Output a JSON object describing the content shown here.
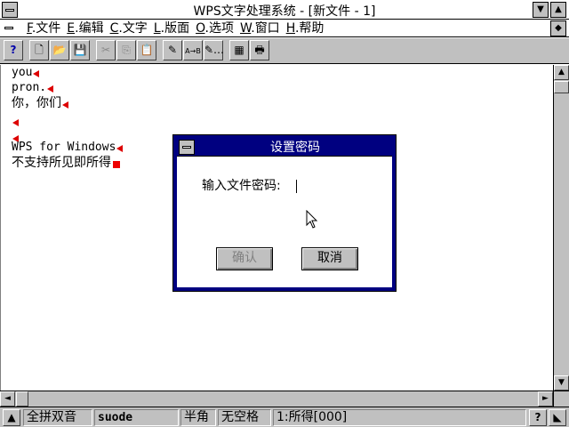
{
  "window": {
    "title": "WPS文字处理系统 - [新文件 - 1]",
    "min_glyph": "▼",
    "max_glyph": "▲"
  },
  "menubar": {
    "items": [
      {
        "key": "F",
        "label": "文件"
      },
      {
        "key": "E",
        "label": "编辑"
      },
      {
        "key": "C",
        "label": "文字"
      },
      {
        "key": "L",
        "label": "版面"
      },
      {
        "key": "O",
        "label": "选项"
      },
      {
        "key": "W",
        "label": "窗口"
      },
      {
        "key": "H",
        "label": "帮助"
      }
    ],
    "restore_glyph": "◆"
  },
  "toolbar": {
    "tools": [
      {
        "name": "help-tool",
        "glyph": "?",
        "disabled": false
      },
      {
        "name": "new-file-tool",
        "glyph": "🗋",
        "disabled": false
      },
      {
        "name": "open-file-tool",
        "glyph": "📂",
        "disabled": false
      },
      {
        "name": "save-file-tool",
        "glyph": "💾",
        "disabled": false
      },
      {
        "name": "cut-tool",
        "glyph": "✂",
        "disabled": true
      },
      {
        "name": "copy-tool",
        "glyph": "⎘",
        "disabled": true
      },
      {
        "name": "paste-tool",
        "glyph": "📋",
        "disabled": false
      },
      {
        "name": "find-tool",
        "glyph": "✎",
        "disabled": false
      },
      {
        "name": "replace-tool",
        "glyph": "A→B",
        "disabled": false
      },
      {
        "name": "find-next-tool",
        "glyph": "✎…",
        "disabled": false
      },
      {
        "name": "calculator-tool",
        "glyph": "▦",
        "disabled": false
      },
      {
        "name": "print-tool",
        "glyph": "🖶",
        "disabled": false
      }
    ]
  },
  "document": {
    "lines": [
      {
        "text": "you",
        "mono": true
      },
      {
        "text": "pron.",
        "mono": true
      },
      {
        "text": "你，你们",
        "mono": false
      },
      {
        "text": "",
        "mono": false
      },
      {
        "text": "",
        "mono": false
      },
      {
        "text": "WPS for Windows",
        "mono": true
      },
      {
        "text": "不支持所见即所得",
        "mono": false
      }
    ]
  },
  "scroll": {
    "up": "▲",
    "down": "▼",
    "left": "◄",
    "right": "►"
  },
  "statusbar": {
    "input_method": "全拼双音",
    "input_code": "suode",
    "width_mode": "半角",
    "space_mode": "无空格",
    "candidate": "1:所得[000]",
    "help_glyph": "?",
    "arrow_glyph": "◣"
  },
  "dialog": {
    "title": "设置密码",
    "prompt": "输入文件密码:",
    "password_value": "",
    "ok_label": "确认",
    "cancel_label": "取消"
  },
  "colors": {
    "dialog_frame": "#000080",
    "marker_red": "#dd0000",
    "chrome_gray": "#c0c0c0"
  }
}
